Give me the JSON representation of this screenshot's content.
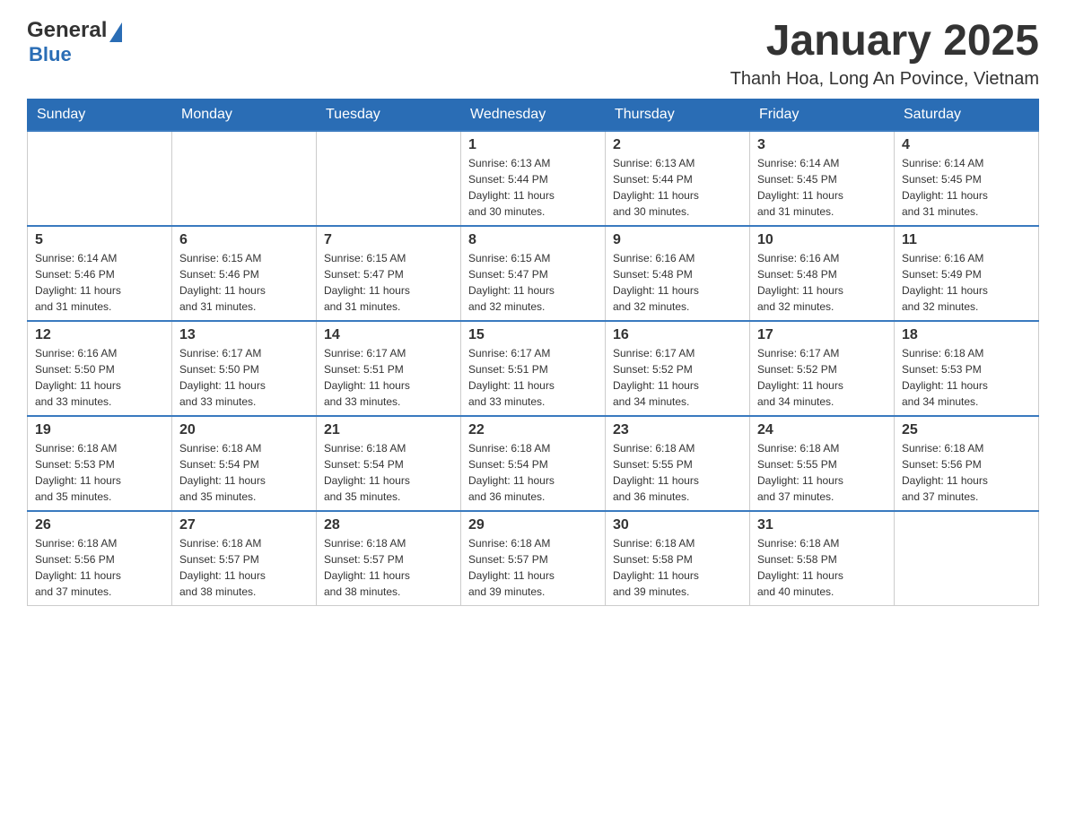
{
  "header": {
    "logo": {
      "general": "General",
      "blue": "Blue"
    },
    "title": "January 2025",
    "location": "Thanh Hoa, Long An Povince, Vietnam"
  },
  "calendar": {
    "days": [
      "Sunday",
      "Monday",
      "Tuesday",
      "Wednesday",
      "Thursday",
      "Friday",
      "Saturday"
    ],
    "weeks": [
      [
        {
          "day": "",
          "info": ""
        },
        {
          "day": "",
          "info": ""
        },
        {
          "day": "",
          "info": ""
        },
        {
          "day": "1",
          "info": "Sunrise: 6:13 AM\nSunset: 5:44 PM\nDaylight: 11 hours\nand 30 minutes."
        },
        {
          "day": "2",
          "info": "Sunrise: 6:13 AM\nSunset: 5:44 PM\nDaylight: 11 hours\nand 30 minutes."
        },
        {
          "day": "3",
          "info": "Sunrise: 6:14 AM\nSunset: 5:45 PM\nDaylight: 11 hours\nand 31 minutes."
        },
        {
          "day": "4",
          "info": "Sunrise: 6:14 AM\nSunset: 5:45 PM\nDaylight: 11 hours\nand 31 minutes."
        }
      ],
      [
        {
          "day": "5",
          "info": "Sunrise: 6:14 AM\nSunset: 5:46 PM\nDaylight: 11 hours\nand 31 minutes."
        },
        {
          "day": "6",
          "info": "Sunrise: 6:15 AM\nSunset: 5:46 PM\nDaylight: 11 hours\nand 31 minutes."
        },
        {
          "day": "7",
          "info": "Sunrise: 6:15 AM\nSunset: 5:47 PM\nDaylight: 11 hours\nand 31 minutes."
        },
        {
          "day": "8",
          "info": "Sunrise: 6:15 AM\nSunset: 5:47 PM\nDaylight: 11 hours\nand 32 minutes."
        },
        {
          "day": "9",
          "info": "Sunrise: 6:16 AM\nSunset: 5:48 PM\nDaylight: 11 hours\nand 32 minutes."
        },
        {
          "day": "10",
          "info": "Sunrise: 6:16 AM\nSunset: 5:48 PM\nDaylight: 11 hours\nand 32 minutes."
        },
        {
          "day": "11",
          "info": "Sunrise: 6:16 AM\nSunset: 5:49 PM\nDaylight: 11 hours\nand 32 minutes."
        }
      ],
      [
        {
          "day": "12",
          "info": "Sunrise: 6:16 AM\nSunset: 5:50 PM\nDaylight: 11 hours\nand 33 minutes."
        },
        {
          "day": "13",
          "info": "Sunrise: 6:17 AM\nSunset: 5:50 PM\nDaylight: 11 hours\nand 33 minutes."
        },
        {
          "day": "14",
          "info": "Sunrise: 6:17 AM\nSunset: 5:51 PM\nDaylight: 11 hours\nand 33 minutes."
        },
        {
          "day": "15",
          "info": "Sunrise: 6:17 AM\nSunset: 5:51 PM\nDaylight: 11 hours\nand 33 minutes."
        },
        {
          "day": "16",
          "info": "Sunrise: 6:17 AM\nSunset: 5:52 PM\nDaylight: 11 hours\nand 34 minutes."
        },
        {
          "day": "17",
          "info": "Sunrise: 6:17 AM\nSunset: 5:52 PM\nDaylight: 11 hours\nand 34 minutes."
        },
        {
          "day": "18",
          "info": "Sunrise: 6:18 AM\nSunset: 5:53 PM\nDaylight: 11 hours\nand 34 minutes."
        }
      ],
      [
        {
          "day": "19",
          "info": "Sunrise: 6:18 AM\nSunset: 5:53 PM\nDaylight: 11 hours\nand 35 minutes."
        },
        {
          "day": "20",
          "info": "Sunrise: 6:18 AM\nSunset: 5:54 PM\nDaylight: 11 hours\nand 35 minutes."
        },
        {
          "day": "21",
          "info": "Sunrise: 6:18 AM\nSunset: 5:54 PM\nDaylight: 11 hours\nand 35 minutes."
        },
        {
          "day": "22",
          "info": "Sunrise: 6:18 AM\nSunset: 5:54 PM\nDaylight: 11 hours\nand 36 minutes."
        },
        {
          "day": "23",
          "info": "Sunrise: 6:18 AM\nSunset: 5:55 PM\nDaylight: 11 hours\nand 36 minutes."
        },
        {
          "day": "24",
          "info": "Sunrise: 6:18 AM\nSunset: 5:55 PM\nDaylight: 11 hours\nand 37 minutes."
        },
        {
          "day": "25",
          "info": "Sunrise: 6:18 AM\nSunset: 5:56 PM\nDaylight: 11 hours\nand 37 minutes."
        }
      ],
      [
        {
          "day": "26",
          "info": "Sunrise: 6:18 AM\nSunset: 5:56 PM\nDaylight: 11 hours\nand 37 minutes."
        },
        {
          "day": "27",
          "info": "Sunrise: 6:18 AM\nSunset: 5:57 PM\nDaylight: 11 hours\nand 38 minutes."
        },
        {
          "day": "28",
          "info": "Sunrise: 6:18 AM\nSunset: 5:57 PM\nDaylight: 11 hours\nand 38 minutes."
        },
        {
          "day": "29",
          "info": "Sunrise: 6:18 AM\nSunset: 5:57 PM\nDaylight: 11 hours\nand 39 minutes."
        },
        {
          "day": "30",
          "info": "Sunrise: 6:18 AM\nSunset: 5:58 PM\nDaylight: 11 hours\nand 39 minutes."
        },
        {
          "day": "31",
          "info": "Sunrise: 6:18 AM\nSunset: 5:58 PM\nDaylight: 11 hours\nand 40 minutes."
        },
        {
          "day": "",
          "info": ""
        }
      ]
    ]
  }
}
